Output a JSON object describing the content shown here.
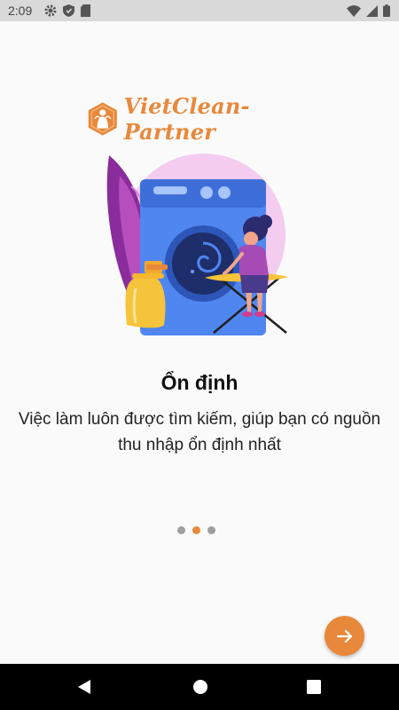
{
  "status_bar": {
    "time": "2:09",
    "left_icons": [
      "gear-icon",
      "shield-icon",
      "sd-card-icon"
    ],
    "right_icons": [
      "wifi-icon",
      "signal-icon",
      "battery-icon"
    ]
  },
  "logo": {
    "text": "VietClean-Partner",
    "icon": "hexagon-logo-icon"
  },
  "onboarding": {
    "illustration": "washing-machine-woman-ironing-illustration",
    "title": "Ổn định",
    "description": "Việc làm luôn được tìm kiếm, giúp bạn có nguồn thu nhập ổn định nhất",
    "page_count": 3,
    "active_page": 2
  },
  "next_button": {
    "icon": "arrow-right-icon"
  },
  "nav_bar": {
    "buttons": [
      "back-icon",
      "home-icon",
      "recents-icon"
    ]
  },
  "colors": {
    "accent": "#e8883a",
    "background": "#fafafa",
    "status_bar": "#d9d9d9",
    "nav_bar": "#000000",
    "machine_blue": "#4f86f0",
    "leaf_purple": "#8a2c9c",
    "bg_circle_pink": "#f3ccef"
  }
}
